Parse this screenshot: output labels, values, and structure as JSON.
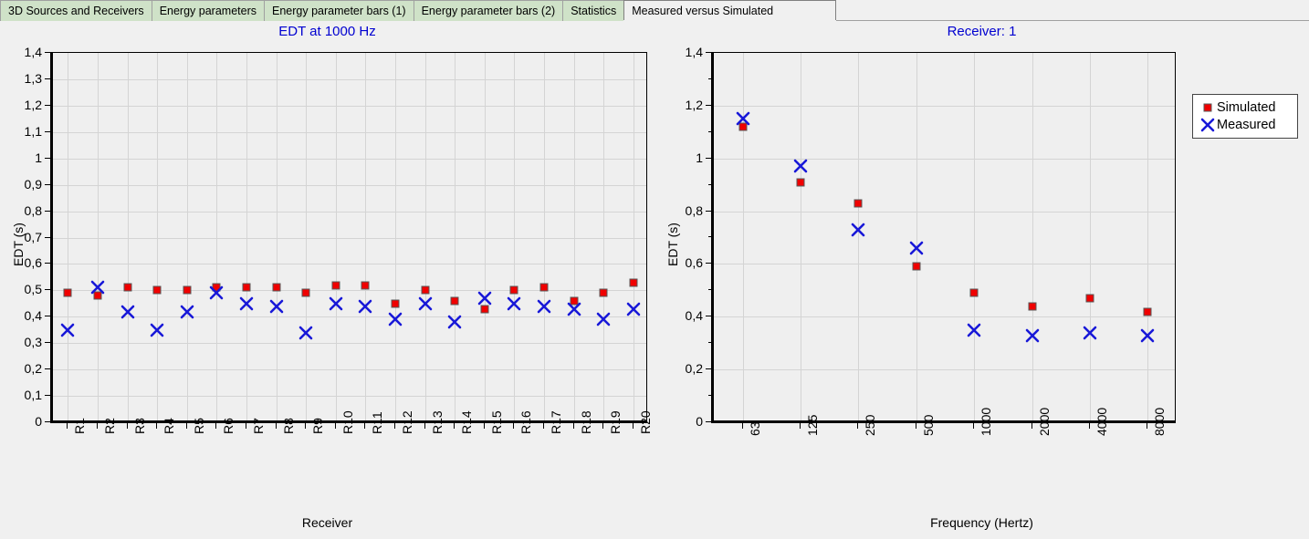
{
  "tabs": [
    {
      "label": "3D Sources and Receivers",
      "active": false
    },
    {
      "label": "Energy parameters",
      "active": false
    },
    {
      "label": "Energy parameter bars (1)",
      "active": false
    },
    {
      "label": "Energy parameter bars (2)",
      "active": false
    },
    {
      "label": "Statistics",
      "active": false
    },
    {
      "label": "Measured versus Simulated",
      "active": true
    }
  ],
  "colors": {
    "simulated": "#f00000",
    "measured": "#1818d8",
    "title": "#0000d0",
    "tab_inactive": "#cfe2c8",
    "tab_active": "#f0f0f0",
    "background": "#f0f0f0",
    "plot_background": "#efefef",
    "grid": "#d4d4d4"
  },
  "legend": {
    "position": "right",
    "entries": [
      {
        "label": "Simulated",
        "marker": "square",
        "color": "#f00000"
      },
      {
        "label": "Measured",
        "marker": "x",
        "color": "#1818d8"
      }
    ]
  },
  "chart_data": [
    {
      "id": "edt-per-receiver",
      "type": "scatter",
      "title": "EDT at 1000 Hz",
      "xlabel": "Receiver",
      "ylabel": "EDT (s)",
      "ylim": [
        0,
        1.4
      ],
      "ytick_step": 0.1,
      "ytick_labels": [
        "0",
        "0,1",
        "0,2",
        "0,3",
        "0,4",
        "0,5",
        "0,6",
        "0,7",
        "0,8",
        "0,9",
        "1",
        "1,1",
        "1,2",
        "1,3",
        "1,4"
      ],
      "grid": true,
      "categories": [
        "R1",
        "R2",
        "R3",
        "R4",
        "R5",
        "R6",
        "R7",
        "R8",
        "R9",
        "R10",
        "R11",
        "R12",
        "R13",
        "R14",
        "R15",
        "R16",
        "R17",
        "R18",
        "R19",
        "R20"
      ],
      "series": [
        {
          "name": "Simulated",
          "marker": "square",
          "color": "#f00000",
          "values": [
            0.49,
            0.48,
            0.51,
            0.5,
            0.5,
            0.51,
            0.51,
            0.51,
            0.49,
            0.52,
            0.52,
            0.45,
            0.5,
            0.46,
            0.43,
            0.5,
            0.51,
            0.46,
            0.49,
            0.53
          ]
        },
        {
          "name": "Measured",
          "marker": "x",
          "color": "#1818d8",
          "values": [
            0.35,
            0.51,
            0.42,
            0.35,
            0.42,
            0.49,
            0.45,
            0.44,
            0.34,
            0.45,
            0.44,
            0.39,
            0.45,
            0.38,
            0.47,
            0.45,
            0.44,
            0.43,
            0.39,
            0.43
          ]
        }
      ]
    },
    {
      "id": "edt-per-frequency",
      "type": "scatter",
      "title": "Receiver: 1",
      "xlabel": "Frequency (Hertz)",
      "ylabel": "EDT (s)",
      "ylim": [
        0,
        1.4
      ],
      "ytick_step": 0.2,
      "ytick_labels": [
        "0",
        "0,2",
        "0,4",
        "0,6",
        "0,8",
        "1",
        "1,2",
        "1,4"
      ],
      "grid": true,
      "categories": [
        "63",
        "125",
        "250",
        "500",
        "1000",
        "2000",
        "4000",
        "8000"
      ],
      "series": [
        {
          "name": "Simulated",
          "marker": "square",
          "color": "#f00000",
          "values": [
            1.12,
            0.91,
            0.83,
            0.59,
            0.49,
            0.44,
            0.47,
            0.42
          ]
        },
        {
          "name": "Measured",
          "marker": "x",
          "color": "#1818d8",
          "values": [
            1.15,
            0.97,
            0.73,
            0.66,
            0.35,
            0.33,
            0.34,
            0.33
          ]
        }
      ]
    }
  ]
}
